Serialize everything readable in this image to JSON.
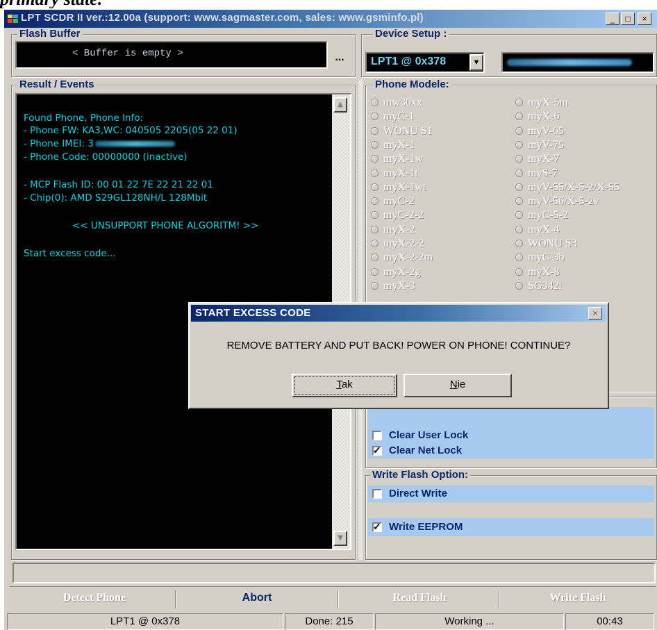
{
  "heading": "primary state.",
  "window": {
    "title": "LPT SCDR II ver.:12.00a (support: www.sagmaster.com, sales: www.gsminfo.pl)",
    "minimize": "_",
    "maximize": "□",
    "close": "×"
  },
  "flash_buffer": {
    "label": "Flash Buffer",
    "text": "< Buffer is empty >",
    "browse": "..."
  },
  "device_setup": {
    "label": "Device Setup :",
    "port": "LPT1 @ 0x378",
    "dropdown": "▼"
  },
  "result": {
    "label": "Result / Events",
    "lines": [
      "Found Phone, Phone Info:",
      "- Phone FW: KA3,WC: 040505 2205(05 22 01)",
      "- Phone IMEI: 3",
      "- Phone Code: 00000000 (inactive)",
      "- MCP  Flash ID: 00 01 22 7E 22 21 22 01",
      "- Chip(0): AMD S29GL128NH/L 128Mbit",
      "<< UNSUPPORT PHONE ALGORITM! >>",
      "Start excess code..."
    ],
    "scroll_up": "▲",
    "scroll_down": "▼"
  },
  "phone_models": {
    "label": "Phone Modele:",
    "col1": [
      "mw30xx",
      "myC-1",
      "WONU S1",
      "myX-1",
      "myX-1w",
      "myX-1t",
      "myX-1wt",
      "myC-2",
      "myC-2-2",
      "myX-2",
      "myX-2-2",
      "myX-2-2m",
      "myX-2g",
      "myX-3"
    ],
    "col2": [
      "myX-5m",
      "myX-6",
      "myV-65",
      "myV-75",
      "myX-7",
      "myS-7",
      "myV-55/X-5-2/X-55",
      "myV-56/X-5-2v",
      "myC-5-2",
      "myX-4",
      "WONU S3",
      "myC-3b",
      "myX-8",
      "SG342i"
    ]
  },
  "options": {
    "clear_user_lock": "Clear User Lock",
    "clear_net_lock": "Clear Net Lock",
    "write_flash_label": "Write Flash Option:",
    "direct_write": "Direct Write",
    "write_eeprom": "Write EEPROM",
    "check": "✓"
  },
  "dialog": {
    "title": "START EXCESS CODE",
    "message": "REMOVE BATTERY AND PUT BACK! POWER ON PHONE! CONTINUE?",
    "yes_underlined": "T",
    "yes_rest": "ak",
    "no_underlined": "N",
    "no_rest": "ie",
    "close": "×"
  },
  "buttons": {
    "detect": "Detect Phone",
    "abort": "Abort",
    "read": "Read Flash",
    "write": "Write Flash"
  },
  "status": {
    "port": "LPT1 @ 0x378",
    "done": "Done: 215",
    "working": "Working ...",
    "time": "00:43"
  }
}
